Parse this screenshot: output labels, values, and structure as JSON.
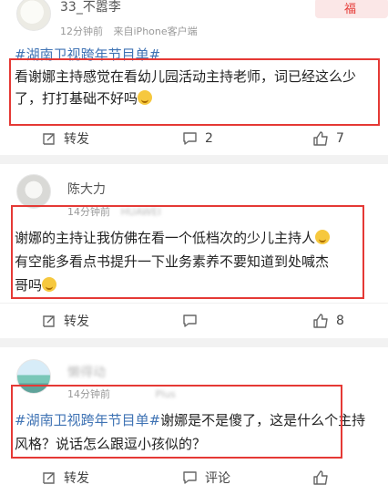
{
  "posts": [
    {
      "username": "33_不嚣李",
      "time": "12分钟前",
      "source": "来自iPhone客户端",
      "tag": "#湖南卫视跨年节目单#",
      "text": "看谢娜主持感觉在看幼儿园活动主持老师，词已经这么少了，打打基础不好吗",
      "emoji": "yum-face-icon",
      "repost_label": "转发",
      "comment_count": "2",
      "like_count": "7"
    },
    {
      "username": "陈大力",
      "time": "14分钟前",
      "source": "HUAWEI",
      "tag": "",
      "text_line1": "谢娜的主持让我仿佛在看一个低档次的少儿主持人",
      "text_line2": "有空能多看点书提升一下业务素养不要知道到处喊杰",
      "text_line3": "哥吗",
      "repost_label": "转发",
      "comment_count": "",
      "like_count": "8"
    },
    {
      "username": "懒得动",
      "time": "14分钟前",
      "source": "Plus",
      "tag": "#湖南卫视跨年节目单#",
      "text": "谢娜是不是傻了，这是什么个主持风格？说话怎么跟逗小孩似的？",
      "repost_label": "转发",
      "comment_label": "评论"
    }
  ],
  "colors": {
    "accent": "#e53935",
    "link": "#3f73b4"
  }
}
